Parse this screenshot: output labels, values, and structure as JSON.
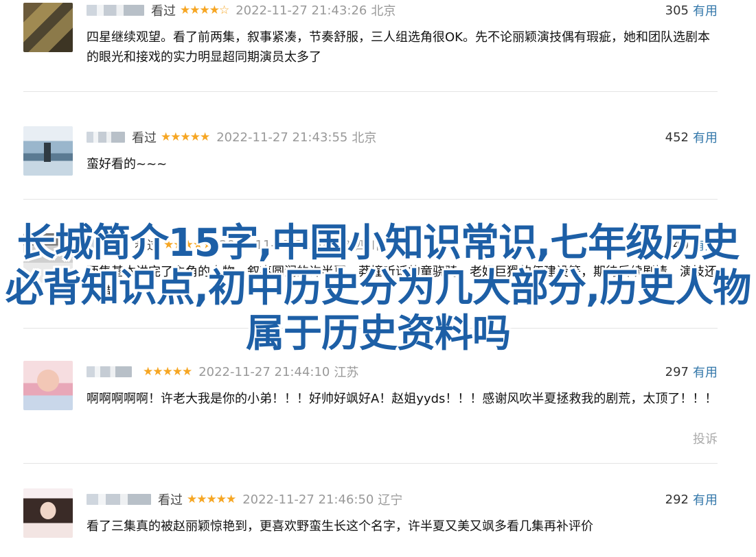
{
  "reviews": [
    {
      "seen": "看过",
      "stars": "★★★★☆",
      "time": "2022-11-27 21:43:26",
      "location": "北京",
      "votes": "305",
      "useful": "有用",
      "text": "四星继续观望。看了前两集，叙事紧凑，节奏舒服，三人组选角很OK。先不论丽颖演技偶有瑕疵，她和团队选剧本的眼光和接戏的实力明显超同期演员太多了"
    },
    {
      "seen": "看过",
      "stars": "★★★★★",
      "time": "2022-11-27 21:43:55",
      "location": "北京",
      "votes": "452",
      "useful": "有用",
      "text": "蛮好看的~~~"
    },
    {
      "seen": "看过",
      "stars": "★★★★★",
      "time": "2022-11-27 21:44:58",
      "location": "四川",
      "votes": "440",
      "useful": "有用",
      "text": "两集基本讲完了主角的人物，叙事圆润的许半夏，莽撞听话的童骁骑，老奸巨猾的伍建设等，期待后续剧情，演技还不错"
    },
    {
      "seen": "",
      "stars": "★★★★★",
      "time": "2022-11-27 21:44:10",
      "location": "江苏",
      "votes": "297",
      "useful": "有用",
      "text": "啊啊啊啊啊！许老大我是你的小弟！！！好帅好飒好A！赵姐yyds！！！感谢风吹半夏拯救我的剧荒，太顶了！！！",
      "report": "投诉"
    },
    {
      "seen": "看过",
      "stars": "★★★★★",
      "time": "2022-11-27 21:46:50",
      "location": "辽宁",
      "votes": "292",
      "useful": "有用",
      "text": "看了三集真的被赵丽颖惊艳到，更喜欢野蛮生长这个名字，许半夏又美又飒多看几集再补评价"
    }
  ],
  "overlay_title": "长城简介15字,中国小知识常识,七年级历史必背知识点,初中历史分为几大部分,历史人物属于历史资料吗",
  "colors": {
    "link": "#3377aa",
    "star": "#f6a623",
    "overlay": "#1d5fa6"
  }
}
